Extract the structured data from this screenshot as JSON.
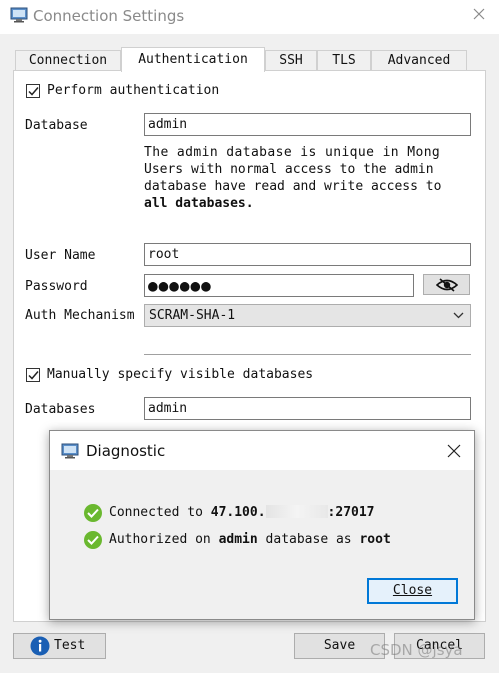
{
  "window": {
    "title": "Connection Settings"
  },
  "tabs": [
    {
      "label": "Connection"
    },
    {
      "label": "Authentication",
      "active": true
    },
    {
      "label": "SSH"
    },
    {
      "label": "TLS"
    },
    {
      "label": "Advanced"
    }
  ],
  "auth": {
    "perform_auth_label": "Perform authentication",
    "perform_auth_checked": true,
    "database_label": "Database",
    "database_value": "admin",
    "desc_line1": "The admin database is unique in Mong",
    "desc_line2": "Users with normal access to the admin",
    "desc_line3": "database have read and write access to",
    "desc_line4": "all databases.",
    "username_label": "User Name",
    "username_value": "root",
    "password_label": "Password",
    "password_masked": "●●●●●●",
    "mechanism_label": "Auth Mechanism",
    "mechanism_value": "SCRAM-SHA-1",
    "visible_dbs_label": "Manually specify visible databases",
    "visible_dbs_checked": true,
    "databases_label": "Databases",
    "databases_value": "admin"
  },
  "footer": {
    "test_label": "Test",
    "save_label": "Save",
    "cancel_label": "Cancel"
  },
  "diagnostic": {
    "title": "Diagnostic",
    "row1_prefix": "Connected to ",
    "row1_host": "47.100.",
    "row1_port": ":27017",
    "row2_prefix": "Authorized on ",
    "row2_db": "admin",
    "row2_mid": " database as ",
    "row2_user": "root",
    "close_label": "Close"
  },
  "watermark": "CSDN @jsya",
  "colors": {
    "accent": "#0078d7",
    "success": "#6ab82f",
    "info": "#1a5fb4"
  }
}
